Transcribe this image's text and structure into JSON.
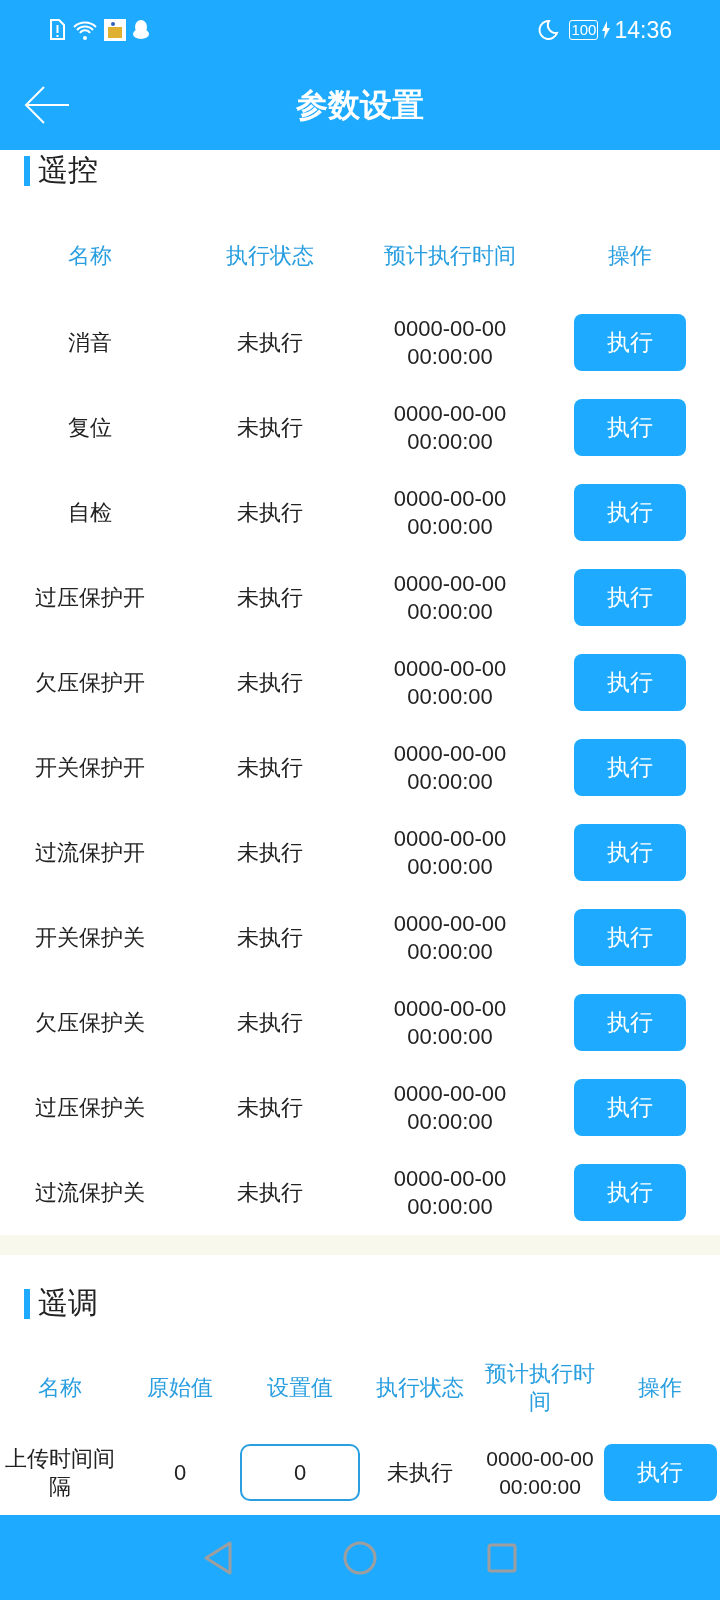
{
  "status_bar": {
    "battery": "100",
    "time": "14:36"
  },
  "header": {
    "title": "参数设置"
  },
  "remote_control": {
    "title": "遥控",
    "columns": [
      "名称",
      "执行状态",
      "预计执行时间",
      "操作"
    ],
    "rows": [
      {
        "name": "消音",
        "status": "未执行",
        "time": "0000-00-00 00:00:00",
        "action": "执行"
      },
      {
        "name": "复位",
        "status": "未执行",
        "time": "0000-00-00 00:00:00",
        "action": "执行"
      },
      {
        "name": "自检",
        "status": "未执行",
        "time": "0000-00-00 00:00:00",
        "action": "执行"
      },
      {
        "name": "过压保护开",
        "status": "未执行",
        "time": "0000-00-00 00:00:00",
        "action": "执行"
      },
      {
        "name": "欠压保护开",
        "status": "未执行",
        "time": "0000-00-00 00:00:00",
        "action": "执行"
      },
      {
        "name": "开关保护开",
        "status": "未执行",
        "time": "0000-00-00 00:00:00",
        "action": "执行"
      },
      {
        "name": "过流保护开",
        "status": "未执行",
        "time": "0000-00-00 00:00:00",
        "action": "执行"
      },
      {
        "name": "开关保护关",
        "status": "未执行",
        "time": "0000-00-00 00:00:00",
        "action": "执行"
      },
      {
        "name": "欠压保护关",
        "status": "未执行",
        "time": "0000-00-00 00:00:00",
        "action": "执行"
      },
      {
        "name": "过压保护关",
        "status": "未执行",
        "time": "0000-00-00 00:00:00",
        "action": "执行"
      },
      {
        "name": "过流保护关",
        "status": "未执行",
        "time": "0000-00-00 00:00:00",
        "action": "执行"
      }
    ]
  },
  "remote_adjust": {
    "title": "遥调",
    "columns": [
      "名称",
      "原始值",
      "设置值",
      "执行状态",
      "预计执行时间",
      "操作"
    ],
    "rows": [
      {
        "name": "上传时间间隔",
        "original": "0",
        "setting": "0",
        "status": "未执行",
        "time": "0000-00-00 00:00:00",
        "action": "执行"
      }
    ]
  }
}
